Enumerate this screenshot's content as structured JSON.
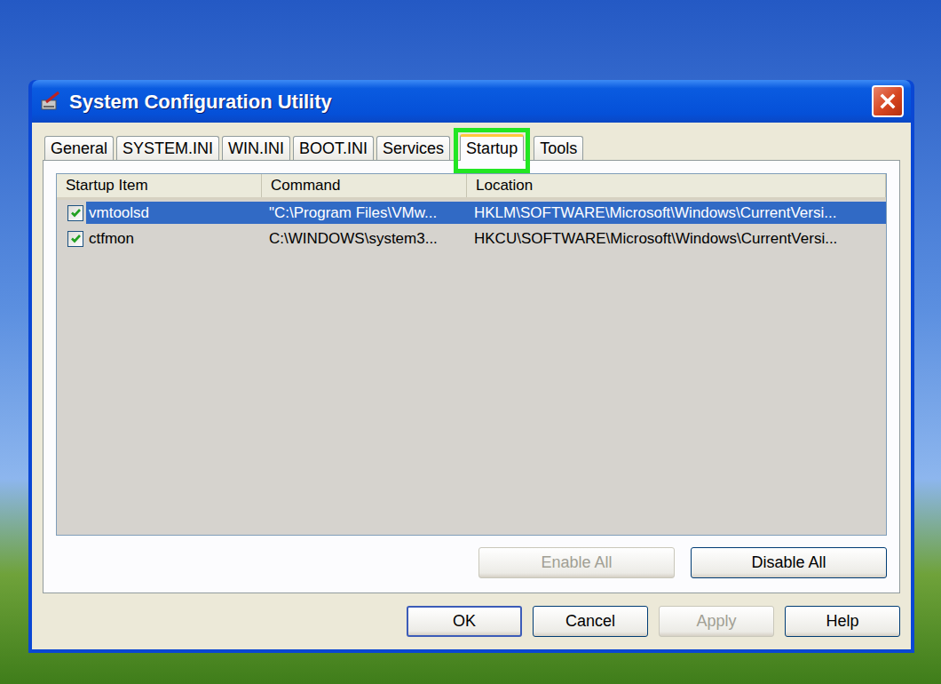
{
  "window": {
    "title": "System Configuration Utility"
  },
  "tabs": [
    {
      "label": "General",
      "selected": false,
      "highlighted": false
    },
    {
      "label": "SYSTEM.INI",
      "selected": false,
      "highlighted": false
    },
    {
      "label": "WIN.INI",
      "selected": false,
      "highlighted": false
    },
    {
      "label": "BOOT.INI",
      "selected": false,
      "highlighted": false
    },
    {
      "label": "Services",
      "selected": false,
      "highlighted": false
    },
    {
      "label": "Startup",
      "selected": true,
      "highlighted": true
    },
    {
      "label": "Tools",
      "selected": false,
      "highlighted": false
    }
  ],
  "table": {
    "columns": [
      "Startup Item",
      "Command",
      "Location"
    ],
    "rows": [
      {
        "cells": [
          "vmtoolsd",
          "\"C:\\Program Files\\VMw...",
          "HKLM\\SOFTWARE\\Microsoft\\Windows\\CurrentVersi..."
        ],
        "checked": true,
        "selected": true
      },
      {
        "cells": [
          "ctfmon",
          "C:\\WINDOWS\\system3...",
          "HKCU\\SOFTWARE\\Microsoft\\Windows\\CurrentVersi..."
        ],
        "checked": true,
        "selected": false
      }
    ]
  },
  "list_buttons": [
    {
      "label": "Enable All",
      "disabled": true
    },
    {
      "label": "Disable All",
      "disabled": false
    }
  ],
  "buttons": [
    {
      "label": "OK",
      "disabled": false,
      "default": true
    },
    {
      "label": "Cancel",
      "disabled": false,
      "default": false
    },
    {
      "label": "Apply",
      "disabled": true,
      "default": false
    },
    {
      "label": "Help",
      "disabled": false,
      "default": false
    }
  ]
}
